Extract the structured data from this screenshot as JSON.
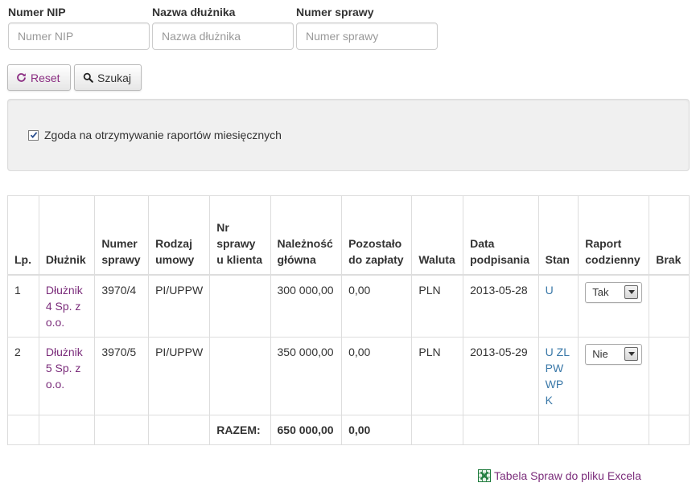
{
  "filters": [
    {
      "label": "Numer NIP",
      "placeholder": "Numer NIP",
      "value": ""
    },
    {
      "label": "Nazwa dłużnika",
      "placeholder": "Nazwa dłużnika",
      "value": ""
    },
    {
      "label": "Numer sprawy",
      "placeholder": "Numer sprawy",
      "value": ""
    }
  ],
  "buttons": {
    "reset": "Reset",
    "search": "Szukaj"
  },
  "consent": {
    "label": "Zgoda na otrzymywanie raportów miesięcznych",
    "checked": true
  },
  "table": {
    "headers": [
      "Lp.",
      "Dłużnik",
      "Numer sprawy",
      "Rodzaj umowy",
      "Nr sprawy u klienta",
      "Należność główna",
      "Pozostało do zapłaty",
      "Waluta",
      "Data podpisania",
      "Stan",
      "Raport codzienny",
      "Brak"
    ],
    "rows": [
      {
        "lp": "1",
        "debtor": "Dłużnik 4 Sp. z o.o.",
        "case_no": "3970/4",
        "contract_type": "PI/UPPW",
        "client_case_no": "",
        "principal": "300 000,00",
        "remaining": "0,00",
        "currency": "PLN",
        "sign_date": "2013-05-28",
        "status": "U",
        "daily_report": "Tak",
        "missing": ""
      },
      {
        "lp": "2",
        "debtor": "Dłużnik 5 Sp. z o.o.",
        "case_no": "3970/5",
        "contract_type": "PI/UPPW",
        "client_case_no": "",
        "principal": "350 000,00",
        "remaining": "0,00",
        "currency": "PLN",
        "sign_date": "2013-05-29",
        "status": "U ZL PW WP K",
        "daily_report": "Nie",
        "missing": ""
      }
    ],
    "footer": {
      "label": "RAZEM:",
      "principal_total": "650 000,00",
      "remaining_total": "0,00"
    }
  },
  "excel_link": "Tabela Spraw do pliku Excela",
  "colors": {
    "link": "#7b2d7b",
    "status_link": "#3a78a8",
    "excel_green": "#1e7b3c"
  }
}
